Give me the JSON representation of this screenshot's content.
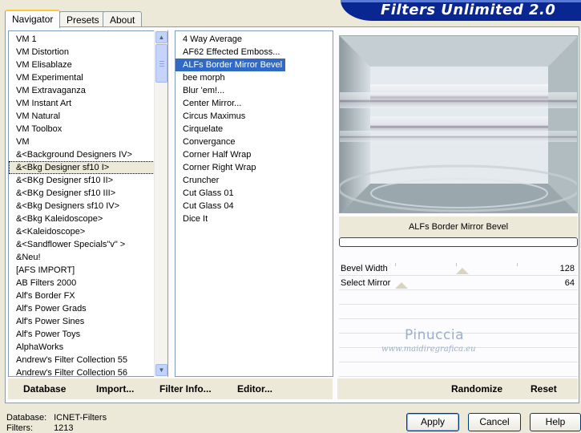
{
  "app_title": "Filters Unlimited 2.0",
  "tabs": [
    {
      "label": "Navigator",
      "active": true
    },
    {
      "label": "Presets",
      "active": false
    },
    {
      "label": "About",
      "active": false
    }
  ],
  "categories": [
    "VM 1",
    "VM Distortion",
    "VM Elisablaze",
    "VM Experimental",
    "VM Extravaganza",
    "VM Instant Art",
    "VM Natural",
    "VM Toolbox",
    "VM",
    "&<Background Designers IV>",
    "&<Bkg Designer sf10 I>",
    "&<BKg Designer sf10 II>",
    "&<BKg Designer sf10 III>",
    "&<Bkg Designers sf10 IV>",
    "&<Bkg Kaleidoscope>",
    "&<Kaleidoscope>",
    "&<Sandflower Specials\"v\" >",
    "&Neu!",
    "[AFS IMPORT]",
    "AB Filters 2000",
    "Alf's Border FX",
    "Alf's Power Grads",
    "Alf's Power Sines",
    "Alf's Power Toys",
    "AlphaWorks",
    "Andrew's Filter Collection 55",
    "Andrew's Filter Collection 56"
  ],
  "selected_category_index": 10,
  "filters": [
    "4 Way Average",
    "AF62 Effected Emboss...",
    "ALFs Border Mirror Bevel",
    "bee morph",
    "Blur 'em!...",
    "Center Mirror...",
    "Circus Maximus",
    "Cirquelate",
    "Convergance",
    "Corner Half Wrap",
    "Corner Right Wrap",
    "Cruncher",
    "Cut Glass 01",
    "Cut Glass 04",
    "Dice It"
  ],
  "selected_filter_index": 2,
  "filter_name": "ALFs Border Mirror Bevel",
  "sliders": [
    {
      "label": "Bevel Width",
      "value": "128",
      "level": 0.5
    },
    {
      "label": "Select Mirror",
      "value": "64",
      "level": 0.0
    }
  ],
  "watermark": {
    "name": "Pinuccia",
    "url": "www.maidiregrafica.eu"
  },
  "toolbar": {
    "database": "Database",
    "import": "Import...",
    "filter_info": "Filter Info...",
    "editor": "Editor...",
    "randomize": "Randomize",
    "reset": "Reset"
  },
  "status": {
    "database_label": "Database:",
    "database_value": "ICNET-Filters",
    "filters_label": "Filters:",
    "filters_value": "1213"
  },
  "buttons": {
    "apply": "Apply",
    "cancel": "Cancel",
    "help": "Help"
  },
  "colors": {
    "banner": "#0a2690",
    "selection": "#316ac5",
    "dialog_bg": "#ece9d8"
  }
}
